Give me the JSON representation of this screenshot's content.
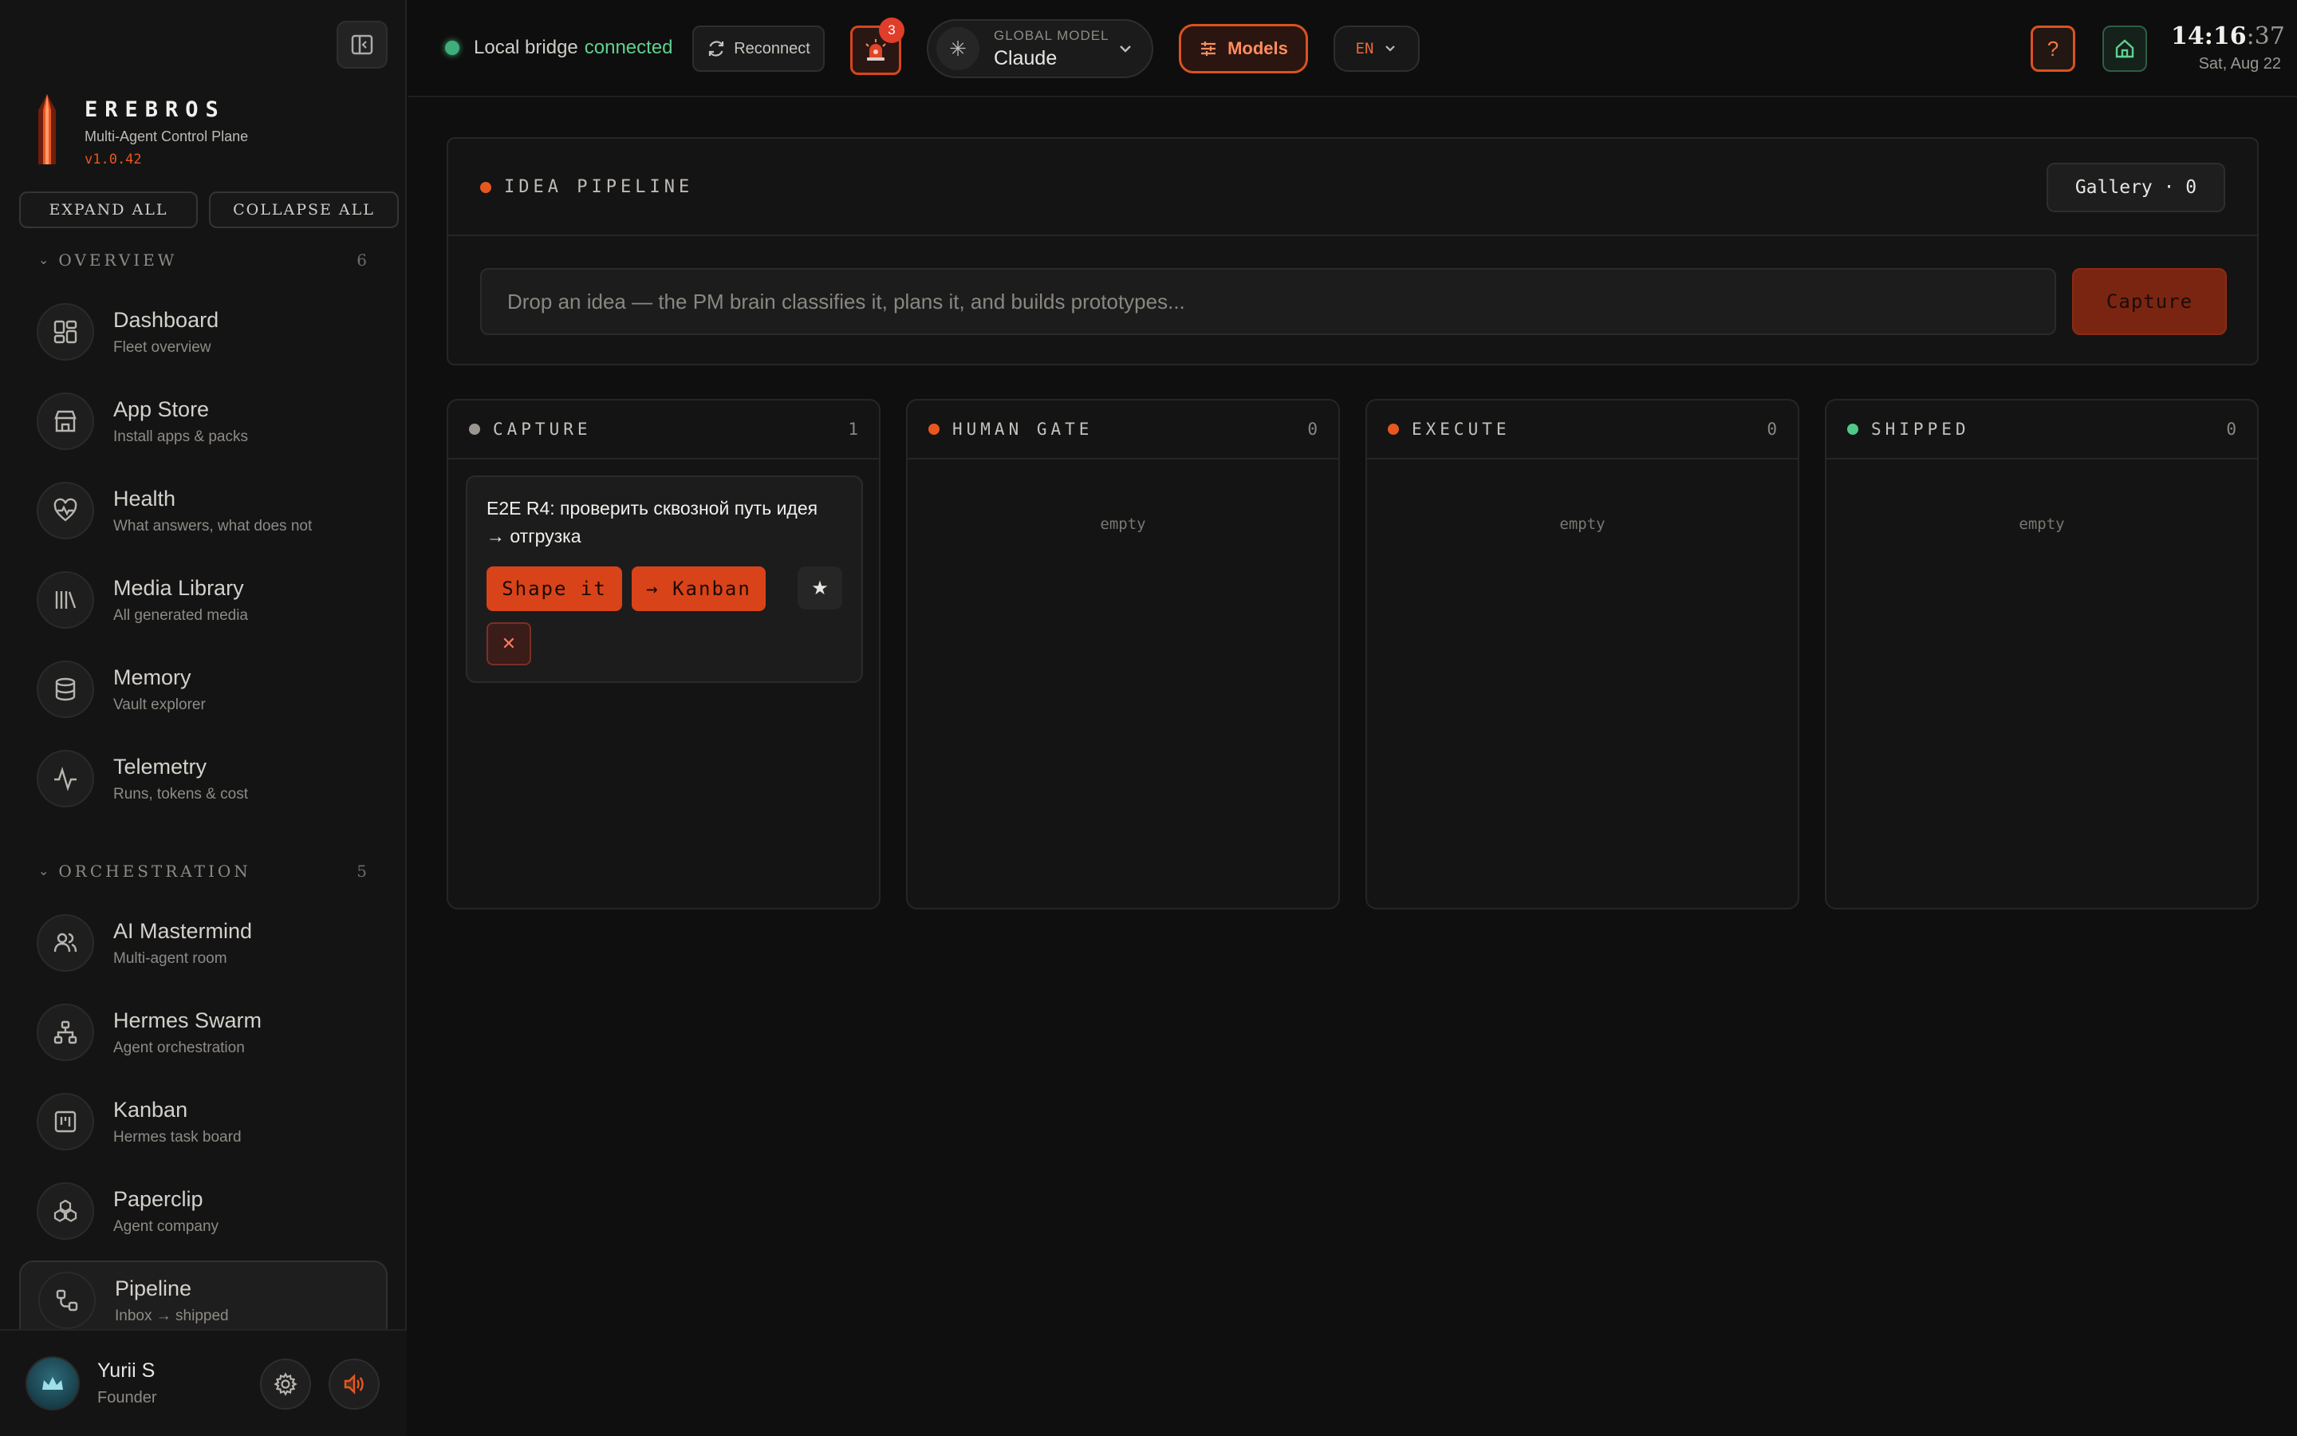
{
  "sidebar": {
    "brand": {
      "name": "EREBROS",
      "subtitle": "Multi-Agent Control Plane",
      "version": "v1.0.42"
    },
    "expand_all": "EXPAND ALL",
    "collapse_all": "COLLAPSE ALL",
    "sections": [
      {
        "label": "OVERVIEW",
        "count": "6"
      },
      {
        "label": "ORCHESTRATION",
        "count": "5"
      }
    ],
    "items": [
      {
        "title": "Dashboard",
        "subtitle": "Fleet overview",
        "icon": "dashboard-icon"
      },
      {
        "title": "App Store",
        "subtitle": "Install apps & packs",
        "icon": "store-icon"
      },
      {
        "title": "Health",
        "subtitle": "What answers, what does not",
        "icon": "heart-pulse-icon"
      },
      {
        "title": "Media Library",
        "subtitle": "All generated media",
        "icon": "library-icon"
      },
      {
        "title": "Memory",
        "subtitle": "Vault explorer",
        "icon": "database-icon"
      },
      {
        "title": "Telemetry",
        "subtitle": "Runs, tokens & cost",
        "icon": "activity-icon"
      },
      {
        "title": "AI Mastermind",
        "subtitle": "Multi-agent room",
        "icon": "users-icon"
      },
      {
        "title": "Hermes Swarm",
        "subtitle": "Agent orchestration",
        "icon": "network-icon"
      },
      {
        "title": "Kanban",
        "subtitle": "Hermes task board",
        "icon": "kanban-icon"
      },
      {
        "title": "Paperclip",
        "subtitle": "Agent company",
        "icon": "boxes-icon"
      },
      {
        "title": "Pipeline",
        "subtitle": "Inbox → shipped",
        "icon": "pipeline-icon"
      }
    ],
    "user": {
      "name": "Yurii S",
      "role": "Founder"
    }
  },
  "topbar": {
    "connection_label": "Local bridge",
    "connection_status": "connected",
    "reconnect": "Reconnect",
    "alert_count": "3",
    "model_label": "GLOBAL MODEL",
    "model_value": "Claude",
    "models_button": "Models",
    "language": "EN",
    "help": "?",
    "clock_hm": "14:16",
    "clock_s": ":37",
    "date": "Sat, Aug 22"
  },
  "pipeline": {
    "title": "IDEA PIPELINE",
    "gallery": "Gallery · 0",
    "input_placeholder": "Drop an idea — the PM brain classifies it, plans it, and builds prototypes...",
    "capture_button": "Capture",
    "columns": [
      {
        "name": "CAPTURE",
        "count": "1",
        "color": "#9a9791"
      },
      {
        "name": "HUMAN GATE",
        "count": "0",
        "color": "#e8571f",
        "empty": "empty"
      },
      {
        "name": "EXECUTE",
        "count": "0",
        "color": "#e8571f",
        "empty": "empty"
      },
      {
        "name": "SHIPPED",
        "count": "0",
        "color": "#4fc987",
        "empty": "empty"
      }
    ],
    "card": {
      "text": "E2E R4: проверить сквозной путь идея → отгрузка",
      "shape_button": "Shape it",
      "kanban_button": "→ Kanban",
      "star": "★",
      "dismiss": "✕"
    }
  },
  "colors": {
    "accent": "#e8571f",
    "success": "#4fc987",
    "background": "#0f0f10"
  }
}
